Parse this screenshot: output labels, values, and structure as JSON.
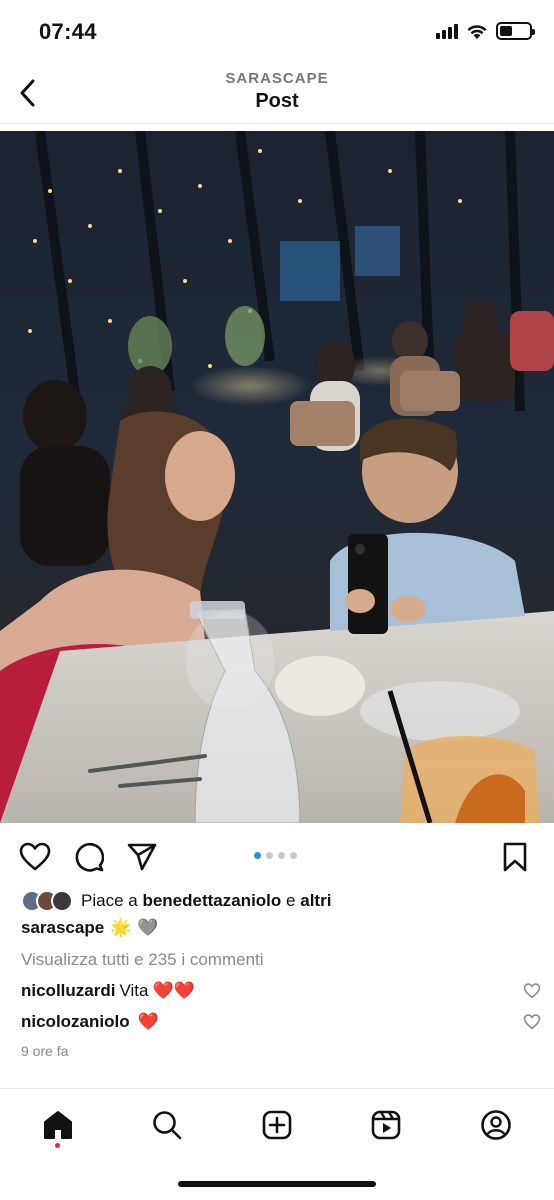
{
  "status_bar": {
    "time": "07:44"
  },
  "header": {
    "username": "SARASCAPE",
    "title": "Post"
  },
  "photo": {
    "alt": ""
  },
  "carousel": {
    "count": 4,
    "active_index": 0
  },
  "likes": {
    "prefix": "Piace a",
    "user": "benedettazaniolo",
    "connector": "e",
    "others": "altri"
  },
  "caption": {
    "user": "sarascape",
    "emojis": [
      "🌟",
      "🩶"
    ]
  },
  "view_comments": "Visualizza tutti e 235 i commenti",
  "comments": [
    {
      "user": "nicolluzardi",
      "text": "Vita",
      "emojis": "❤️❤️"
    },
    {
      "user": "nicolozaniolo",
      "text": "",
      "emojis": "❤️"
    }
  ],
  "timestamp": "9 ore fa",
  "icons": {
    "back": "chevron-left-icon",
    "like": "heart-icon",
    "comment": "comment-bubble-icon",
    "share": "paper-plane-icon",
    "save": "bookmark-icon",
    "nav": [
      "home-icon",
      "search-icon",
      "create-icon",
      "reels-icon",
      "profile-icon"
    ]
  },
  "colors": {
    "accent": "#2f8ee8",
    "notification": "#e0264a",
    "muted": "#8a8a8a"
  }
}
